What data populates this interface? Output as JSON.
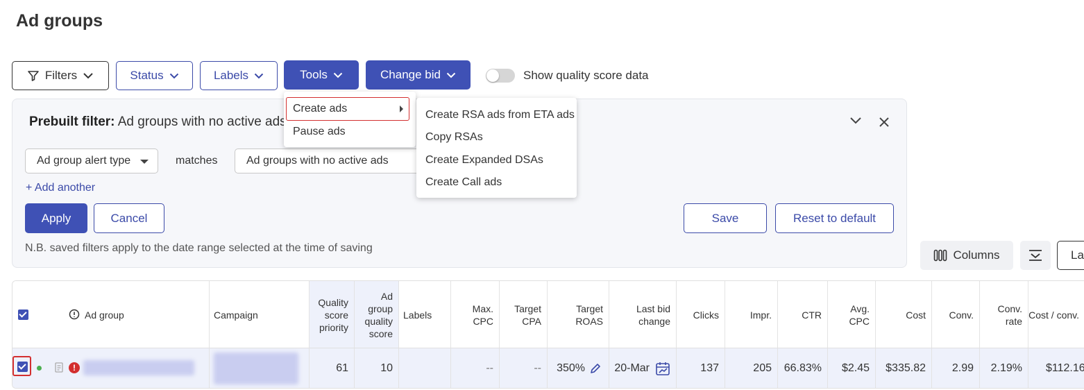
{
  "page": {
    "title": "Ad groups"
  },
  "toolbar": {
    "filters": "Filters",
    "status": "Status",
    "labels": "Labels",
    "tools": "Tools",
    "change_bid": "Change bid",
    "quality_toggle": "Show quality score data",
    "columns": "Columns",
    "layout_partial": "La"
  },
  "tools_menu": {
    "items": [
      "Create ads",
      "Pause ads"
    ]
  },
  "create_ads_submenu": {
    "items": [
      "Create RSA ads from ETA ads",
      "Copy RSAs",
      "Create Expanded DSAs",
      "Create Call ads"
    ]
  },
  "filter_panel": {
    "prebuilt_label": "Prebuilt filter:",
    "prebuilt_value": "Ad groups with no active ads",
    "field": "Ad group alert type",
    "operator": "matches",
    "value": "Ad groups with no active ads",
    "add_another": "+ Add another",
    "apply": "Apply",
    "cancel": "Cancel",
    "save": "Save",
    "reset": "Reset to default",
    "note": "N.B. saved filters apply to the date range selected at the time of saving"
  },
  "table": {
    "headers": {
      "ad_group": "Ad group",
      "campaign": "Campaign",
      "qs_priority": "Quality score priority",
      "ag_quality": "Ad group quality score",
      "labels": "Labels",
      "max_cpc": "Max. CPC",
      "target_cpa": "Target CPA",
      "target_roas": "Target ROAS",
      "last_bid": "Last bid change",
      "clicks": "Clicks",
      "impr": "Impr.",
      "ctr": "CTR",
      "avg_cpc": "Avg. CPC",
      "cost": "Cost",
      "conv": "Conv.",
      "conv_rate": "Conv. rate",
      "cost_conv": "Cost / conv."
    },
    "row": {
      "qs_priority": "61",
      "ag_quality": "10",
      "max_cpc": "--",
      "target_cpa": "--",
      "target_roas": "350%",
      "last_bid": "20-Mar",
      "clicks": "137",
      "impr": "205",
      "ctr": "66.83%",
      "avg_cpc": "$2.45",
      "cost": "$335.82",
      "conv": "2.99",
      "conv_rate": "2.19%",
      "cost_conv": "$112.16"
    }
  }
}
